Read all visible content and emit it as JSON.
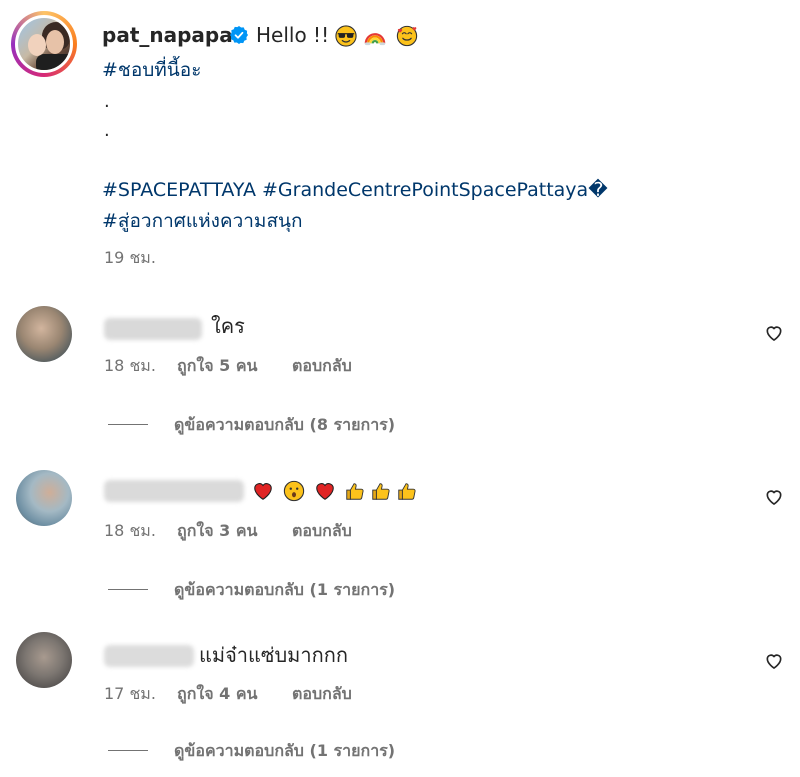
{
  "post": {
    "username": "pat_napapa",
    "caption": "Hello !!",
    "caption_emojis": [
      "sunglasses-emoji",
      "rainbow-emoji",
      "smiling-hearts-emoji"
    ],
    "hashtag_line1": "#ชอบที่นี้อะ",
    "dots": [
      ".",
      "."
    ],
    "hashtag_line2": "#SPACEPATTAYA #GrandeCentrePointSpacePattaya�",
    "hashtag_line3": "#สู่อวกาศแห่งความสนุก",
    "time": "19 ชม."
  },
  "comments": [
    {
      "text": "ใคร",
      "emojis": [],
      "time": "18 ชม.",
      "likes_label": "ถูกใจ 5 คน",
      "reply_label": "ตอบกลับ",
      "view_replies": "ดูข้อความตอบกลับ (8 รายการ)"
    },
    {
      "text": "",
      "emojis": [
        "red-heart-emoji",
        "astonished-face-emoji",
        "red-heart-emoji",
        "thumbs-up-emoji",
        "thumbs-up-emoji",
        "thumbs-up-emoji"
      ],
      "time": "18 ชม.",
      "likes_label": "ถูกใจ 3 คน",
      "reply_label": "ตอบกลับ",
      "view_replies": "ดูข้อความตอบกลับ (1 รายการ)"
    },
    {
      "text": "แม่จ๋าแซ่บมากกก",
      "emojis": [],
      "time": "17 ชม.",
      "likes_label": "ถูกใจ 4 คน",
      "reply_label": "ตอบกลับ",
      "view_replies": "ดูข้อความตอบกลับ (1 รายการ)"
    }
  ],
  "colors": {
    "hashtag": "#00376b",
    "secondary_text": "#737373",
    "primary_text": "#262626",
    "verified": "#0095f6"
  }
}
